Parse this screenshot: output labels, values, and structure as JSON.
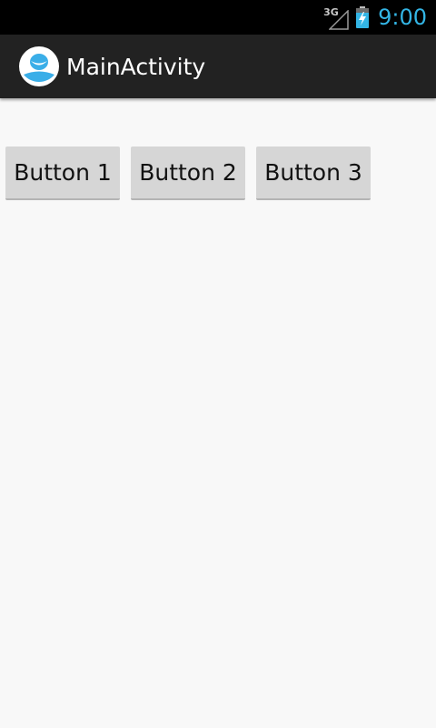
{
  "status_bar": {
    "network_type": "3G",
    "time": "9:00",
    "signal_icon": "cell-signal-empty-icon",
    "battery_icon": "battery-charging-icon",
    "clock_color": "#33b5e5"
  },
  "action_bar": {
    "title": "MainActivity",
    "app_icon": "app-launcher-face-icon",
    "icon_color": "#3aaee8"
  },
  "buttons": [
    {
      "label": "Button 1"
    },
    {
      "label": "Button 2"
    },
    {
      "label": "Button 3"
    }
  ]
}
